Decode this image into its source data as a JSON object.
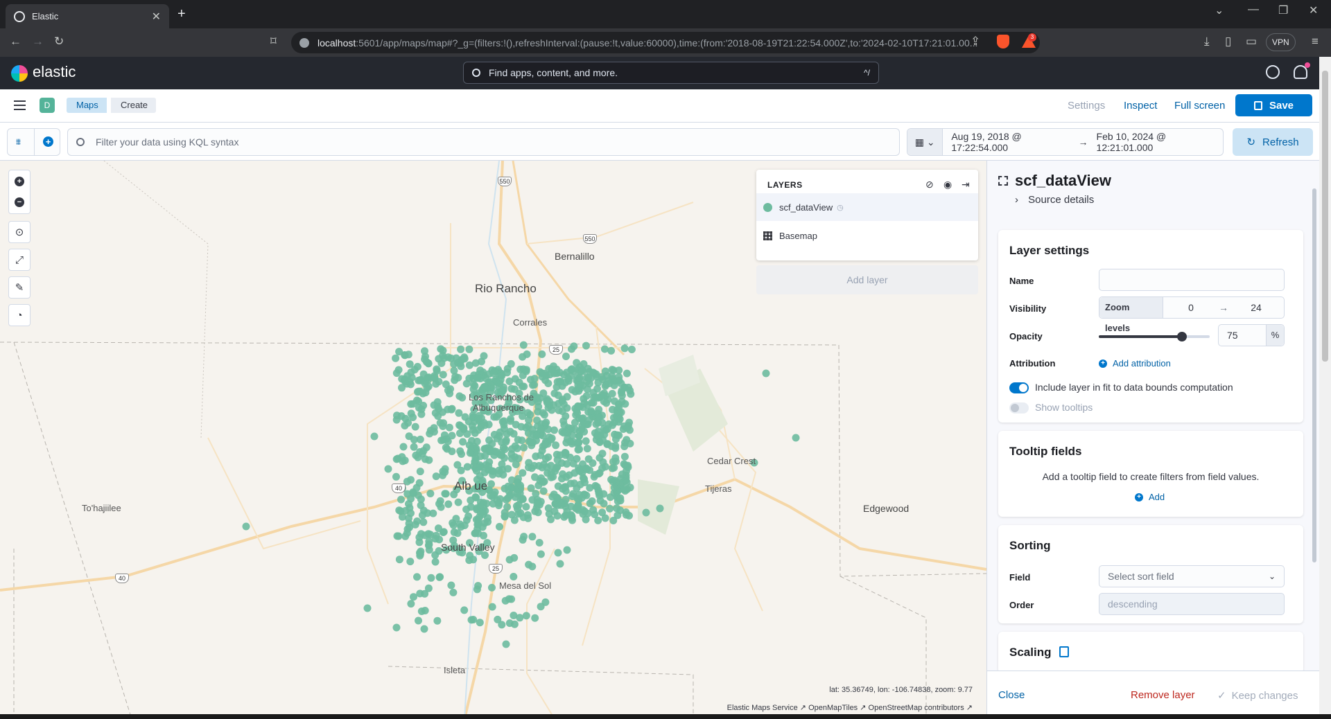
{
  "browser": {
    "tab_title": "Elastic",
    "url_host": "localhost",
    "url_rest": ":5601/app/maps/map#?_g=(filters:!(),refreshInterval:(pause:!t,value:60000),time:(from:'2018-08-19T21:22:54.000Z',to:'2024-02-10T17:21:01.00...",
    "vpn_label": "VPN",
    "brave_badge": "3"
  },
  "kibana": {
    "brand": "elastic",
    "search_placeholder": "Find apps, content, and more.",
    "search_shortcut": "^/"
  },
  "appbar": {
    "space_initial": "D",
    "breadcrumbs": [
      "Maps",
      "Create"
    ],
    "links": {
      "settings": "Settings",
      "inspect": "Inspect",
      "fullscreen": "Full screen"
    },
    "save_label": "Save"
  },
  "query": {
    "kql_placeholder": "Filter your data using KQL syntax",
    "date_from": "Aug 19, 2018 @ 17:22:54.000",
    "date_arrow": "→",
    "date_to": "Feb 10, 2024 @ 12:21:01.000",
    "refresh_label": "Refresh"
  },
  "map": {
    "places": {
      "rio_rancho": "Rio Rancho",
      "bernalillo": "Bernalillo",
      "corrales": "Corrales",
      "los_ranchos_1": "Los Ranchos de",
      "los_ranchos_2": "Albuquerque",
      "albuquerque_partial": "Alb   ue",
      "cedar_crest": "Cedar Crest",
      "tijeras": "Tijeras",
      "edgewood": "Edgewood",
      "tohajiilee": "To'hajiilee",
      "south_valley": "South Valley",
      "mesa_del_sol": "Mesa del Sol",
      "isleta": "Isleta"
    },
    "shields": {
      "s550a": "550",
      "s550b": "550",
      "s25a": "25",
      "s40a": "40",
      "s25b": "25",
      "s40b": "40"
    },
    "coords": "lat: 35.36749, lon: -106.74838, zoom: 9.77",
    "attribution": [
      "Elastic Maps Service",
      "OpenMapTiles",
      "OpenStreetMap contributors"
    ],
    "point_color": "#6dbb9f"
  },
  "layers_panel": {
    "title": "LAYERS",
    "items": [
      {
        "name": "scf_dataView",
        "icon": "circle-icon"
      },
      {
        "name": "Basemap",
        "icon": "grid-icon"
      }
    ],
    "add_layer": "Add layer"
  },
  "flyout": {
    "title": "scf_dataView",
    "source_details": "Source details",
    "layer_settings": {
      "title": "Layer settings",
      "name_label": "Name",
      "name_value": "",
      "visibility_label": "Visibility",
      "zoom_levels_label": "Zoom levels",
      "zoom_min": "0",
      "zoom_max": "24",
      "opacity_label": "Opacity",
      "opacity_value": "75",
      "opacity_unit": "%",
      "opacity_fraction": 0.75,
      "attribution_label": "Attribution",
      "add_attribution": "Add attribution",
      "include_fit": "Include layer in fit to data bounds computation",
      "show_tooltips": "Show tooltips"
    },
    "tooltip_fields": {
      "title": "Tooltip fields",
      "hint": "Add a tooltip field to create filters from field values.",
      "add": "Add"
    },
    "sorting": {
      "title": "Sorting",
      "field_label": "Field",
      "field_placeholder": "Select sort field",
      "order_label": "Order",
      "order_value": "descending"
    },
    "scaling": {
      "title": "Scaling"
    },
    "footer": {
      "close": "Close",
      "remove": "Remove layer",
      "keep": "Keep changes"
    }
  }
}
